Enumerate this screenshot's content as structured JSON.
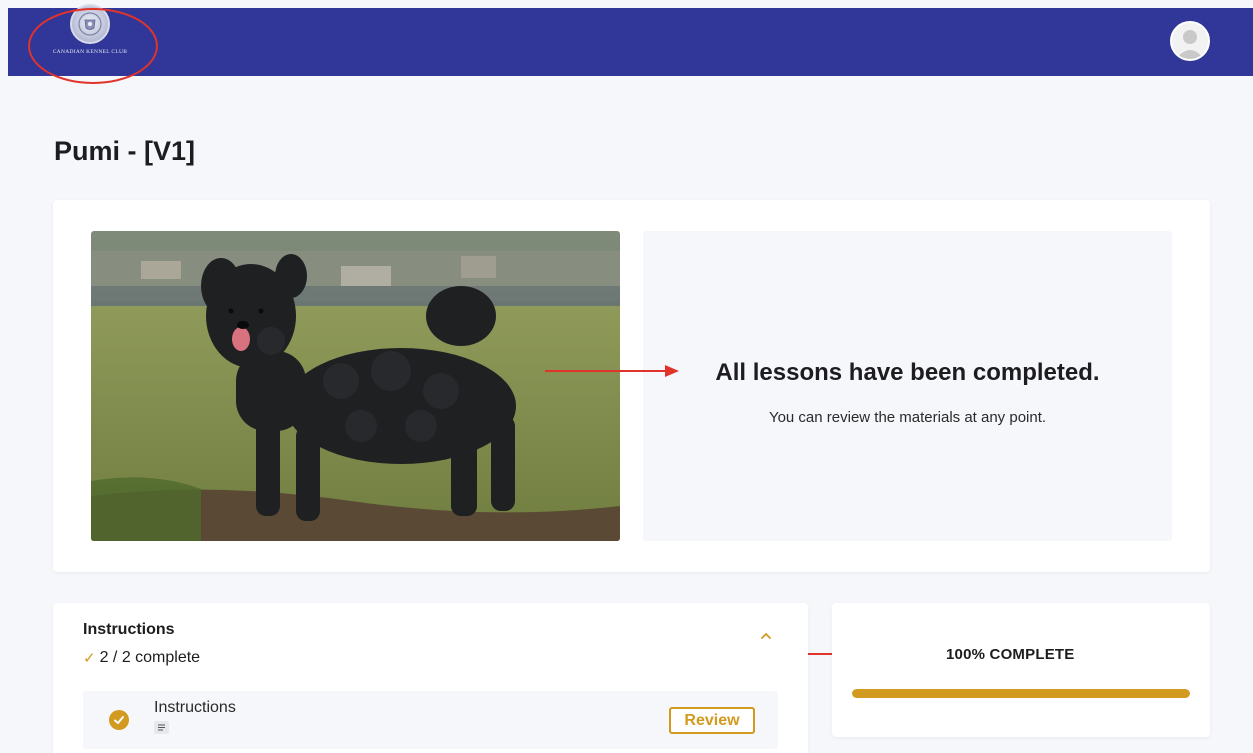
{
  "header": {
    "logo_text": "CANADIAN KENNEL CLUB",
    "avatar_icon": "user-avatar-icon",
    "brand_color": "#303799"
  },
  "page": {
    "title": "Pumi - [V1]"
  },
  "hero": {
    "image_icon": "dog-photo",
    "heading": "All lessons have been completed.",
    "subtext": "You can review the materials at any point."
  },
  "section": {
    "title": "Instructions",
    "progress_text": "2 / 2 complete",
    "collapse_icon": "chevron-up-icon",
    "lessons": [
      {
        "name": "Instructions",
        "status_icon": "check-circle-icon",
        "type_icon": "document-icon",
        "action_label": "Review"
      }
    ]
  },
  "progress": {
    "label": "100% COMPLETE",
    "fraction": 1.0,
    "accent_color": "#d29a1e"
  },
  "annotation_color": "#e0332a"
}
